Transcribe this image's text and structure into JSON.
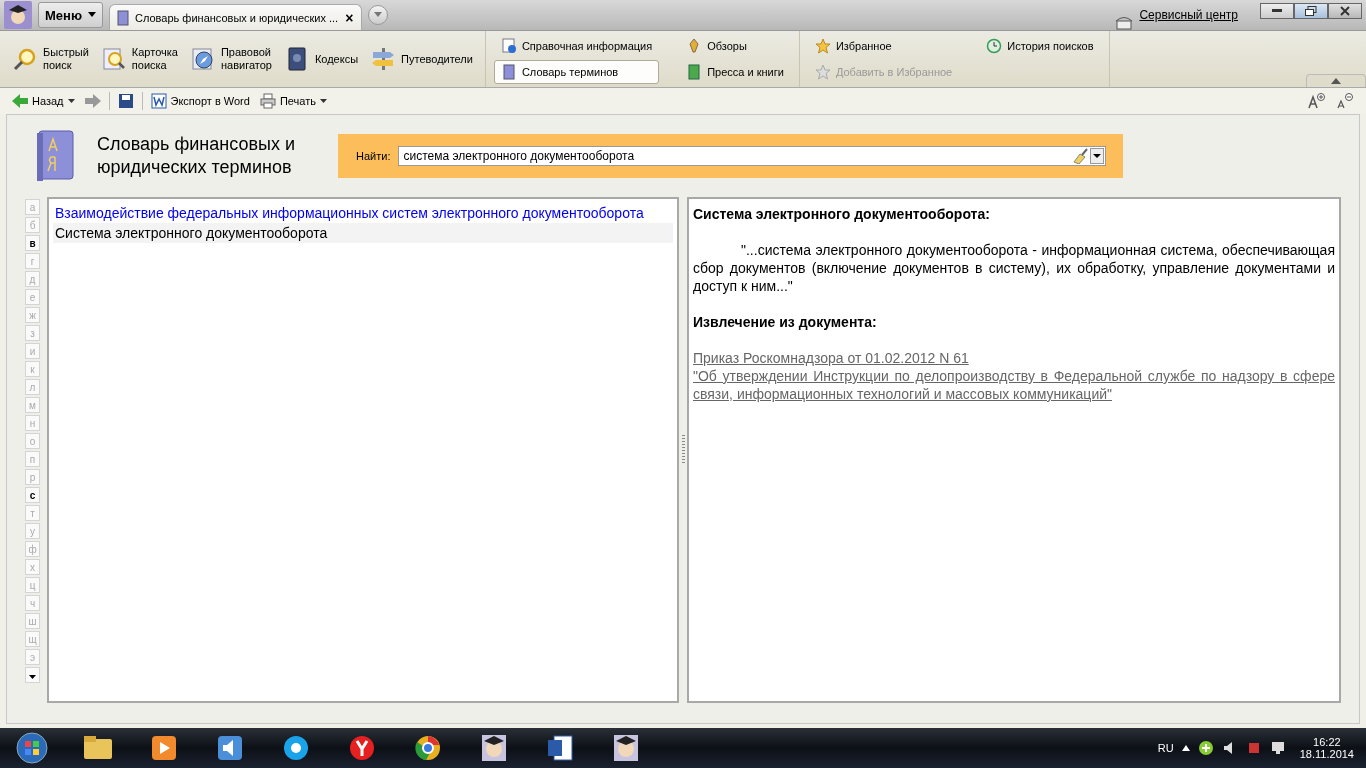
{
  "window": {
    "menu_button": "Меню",
    "tab": {
      "title": "Словарь финансовых и юридических ...",
      "close": "×"
    },
    "service_link": "Сервисный центр"
  },
  "ribbon": {
    "main": [
      {
        "label": "Быстрый поиск"
      },
      {
        "label": "Карточка поиска"
      },
      {
        "label": "Правовой навигатор"
      },
      {
        "label": "Кодексы"
      },
      {
        "label": "Путеводители"
      }
    ],
    "reference": [
      {
        "label": "Справочная информация",
        "selected": false
      },
      {
        "label": "Словарь терминов",
        "selected": true
      },
      {
        "label": "Обзоры",
        "selected": false
      },
      {
        "label": "Пресса и книги",
        "selected": false
      }
    ],
    "favorites": [
      {
        "label": "Избранное",
        "disabled": false
      },
      {
        "label": "История поисков",
        "disabled": false
      },
      {
        "label": "Добавить в Избранное",
        "disabled": true
      }
    ]
  },
  "toolbar": {
    "back": "Назад",
    "export": "Экспорт в Word",
    "print": "Печать"
  },
  "dictionary": {
    "title": "Словарь финансовых и юридических терминов",
    "search": {
      "label": "Найти:",
      "value": "система электронного документооборота"
    }
  },
  "letters": [
    {
      "label": "а",
      "disabled": true
    },
    {
      "label": "б",
      "disabled": true
    },
    {
      "label": "в",
      "disabled": false
    },
    {
      "label": "г",
      "disabled": true
    },
    {
      "label": "д",
      "disabled": true
    },
    {
      "label": "е",
      "disabled": true
    },
    {
      "label": "ж",
      "disabled": true
    },
    {
      "label": "з",
      "disabled": true
    },
    {
      "label": "и",
      "disabled": true
    },
    {
      "label": "к",
      "disabled": true
    },
    {
      "label": "л",
      "disabled": true
    },
    {
      "label": "м",
      "disabled": true
    },
    {
      "label": "н",
      "disabled": true
    },
    {
      "label": "о",
      "disabled": true
    },
    {
      "label": "п",
      "disabled": true
    },
    {
      "label": "р",
      "disabled": true
    },
    {
      "label": "с",
      "disabled": false
    },
    {
      "label": "т",
      "disabled": true
    },
    {
      "label": "у",
      "disabled": true
    },
    {
      "label": "ф",
      "disabled": true
    },
    {
      "label": "х",
      "disabled": true
    },
    {
      "label": "ц",
      "disabled": true
    },
    {
      "label": "ч",
      "disabled": true
    },
    {
      "label": "ш",
      "disabled": true
    },
    {
      "label": "щ",
      "disabled": true
    },
    {
      "label": "э",
      "disabled": true
    }
  ],
  "terms": [
    {
      "label": "Взаимодействие федеральных информационных систем электронного документооборота",
      "hover": true,
      "selected": false
    },
    {
      "label": "Система электронного документооборота",
      "hover": false,
      "selected": true
    }
  ],
  "article": {
    "heading": "Система электронного документооборота:",
    "quote": "\"...система электронного документооборота - информационная система, обеспечивающая сбор документов (включение документов в систему), их обработку, управление документами и доступ к ним...\"",
    "extract_heading": "Извлечение из документа:",
    "source_links": [
      "Приказ Роскомнадзора от 01.02.2012 N 61",
      "\"Об утверждении Инструкции по делопроизводству в Федеральной службе по надзору в сфере связи, информационных технологий и массовых коммуникаций\""
    ]
  },
  "taskbar": {
    "language": "RU",
    "time": "16:22",
    "date": "18.11.2014"
  }
}
